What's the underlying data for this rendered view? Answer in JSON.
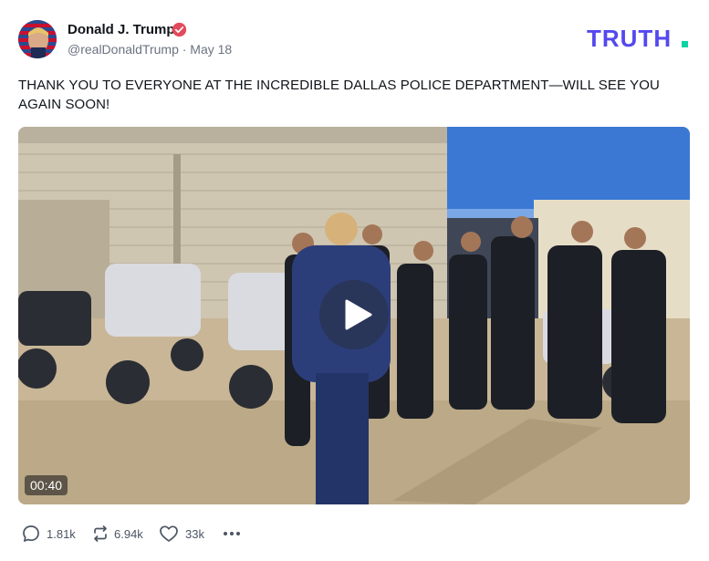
{
  "post": {
    "author": {
      "display_name": "Donald J. Trump",
      "handle": "@realDonaldTrump",
      "date": "May 18",
      "handle_line": "@realDonaldTrump · May 18",
      "verified": true
    },
    "brand": {
      "logo_text": "TRUTH.",
      "color": "#5448ee",
      "accent": "#0bd3a4"
    },
    "text": "THANK YOU TO EVERYONE AT THE INCREDIBLE DALLAS POLICE DEPARTMENT—WILL SEE YOU AGAIN SOON!",
    "media": {
      "type": "video",
      "duration": "00:40"
    },
    "actions": {
      "replies": "1.81k",
      "retruths": "6.94k",
      "likes": "33k"
    }
  }
}
